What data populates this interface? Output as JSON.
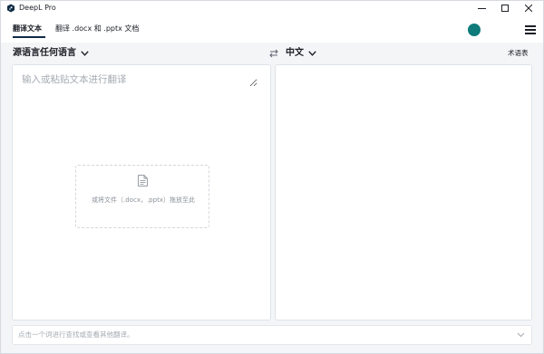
{
  "window": {
    "title": "DeepL Pro",
    "minimize_icon": "minimize-icon",
    "maximize_icon": "maximize-icon",
    "close_icon": "close-icon"
  },
  "header": {
    "tabs": [
      {
        "label": "翻译文本",
        "active": true
      },
      {
        "label": "翻译 .docx 和 .pptx 文档",
        "active": false
      }
    ],
    "avatar_color": "#0f7a7a",
    "menu_icon": "hamburger-menu-icon"
  },
  "language_bar": {
    "source_language": "源语言任何语言",
    "target_language": "中文",
    "swap_icon": "swap-arrows-icon",
    "glossary_label": "术语表"
  },
  "source_pane": {
    "placeholder": "输入或粘贴文本进行翻译",
    "value": "",
    "dropzone": {
      "icon": "document-icon",
      "text": "或将文件（.docx，.pptx）拖放至此"
    }
  },
  "target_pane": {
    "value": ""
  },
  "bottom_bar": {
    "hint": "点击一个词进行查找或查看其他翻译。",
    "expand_icon": "chevron-down-icon"
  },
  "colors": {
    "accent": "#0f2b46",
    "avatar": "#0f7a7a",
    "background": "#f3f5f7",
    "placeholder": "#a6abb2"
  }
}
